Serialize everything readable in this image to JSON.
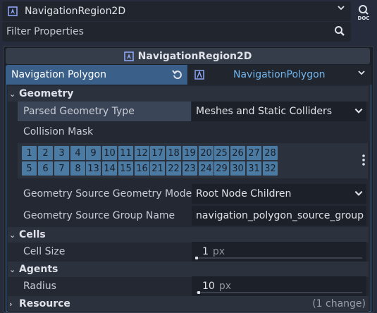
{
  "node_selector": {
    "name": "NavigationRegion2D",
    "icon": "navigation-region-icon"
  },
  "filter": {
    "placeholder": "Filter Properties",
    "value": ""
  },
  "resource_header": {
    "title": "NavigationRegion2D"
  },
  "navigation_polygon": {
    "label": "Navigation Polygon",
    "value": "NavigationPolygon",
    "value_color": "#72b4ec"
  },
  "sections": {
    "geometry": {
      "title": "Geometry",
      "expanded": true
    },
    "cells": {
      "title": "Cells",
      "expanded": true
    },
    "agents": {
      "title": "Agents",
      "expanded": true
    },
    "resource": {
      "title": "Resource",
      "expanded": false,
      "change_note": "(1 change)"
    }
  },
  "properties": {
    "parsed_geometry_type": {
      "label": "Parsed Geometry Type",
      "value": "Meshes and Static Colliders"
    },
    "collision_mask": {
      "label": "Collision Mask"
    },
    "source_geometry_mode": {
      "label": "Geometry Source Geometry Mode",
      "value": "Root Node Children"
    },
    "source_group_name": {
      "label": "Geometry Source Group Name",
      "value": "navigation_polygon_source_group"
    },
    "cell_size": {
      "label": "Cell Size",
      "value": "1",
      "unit": "px"
    },
    "radius": {
      "label": "Radius",
      "value": "10",
      "unit": "px"
    }
  },
  "collision_layers": {
    "groups": [
      {
        "top": [
          "1",
          "2",
          "3",
          "4"
        ],
        "bottom": [
          "5",
          "6",
          "7",
          "8"
        ]
      },
      {
        "top": [
          "9",
          "10",
          "11",
          "12"
        ],
        "bottom": [
          "13",
          "14",
          "15",
          "16"
        ]
      },
      {
        "top": [
          "17",
          "18",
          "19",
          "20"
        ],
        "bottom": [
          "21",
          "22",
          "23",
          "24"
        ]
      },
      {
        "top": [
          "25",
          "26",
          "27",
          "28"
        ],
        "bottom": [
          "29",
          "30",
          "31",
          "32"
        ]
      }
    ],
    "active_color": "#4b7aa3"
  },
  "colors": {
    "accent": "#3a5f88",
    "background": "#262c3b"
  }
}
